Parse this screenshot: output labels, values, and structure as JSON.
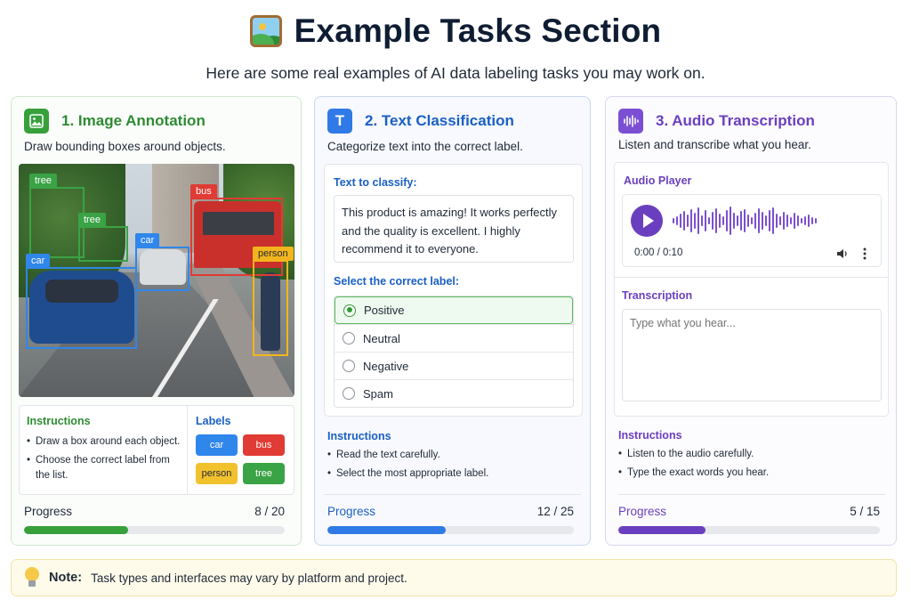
{
  "header": {
    "title": "Example Tasks Section",
    "icon": "landscape-picture-icon",
    "subtitle": "Here are some real examples of AI data labeling tasks you may work on."
  },
  "colors": {
    "green": "#2e8b32",
    "blue": "#1a5fc4",
    "purple": "#6a3fbf",
    "note_bg": "#fffbea"
  },
  "image_task": {
    "title": "1. Image Annotation",
    "description": "Draw bounding boxes around objects.",
    "boxes": [
      {
        "label": "tree",
        "color": "#3aa345"
      },
      {
        "label": "tree",
        "color": "#3aa345"
      },
      {
        "label": "bus",
        "color": "#e03b34"
      },
      {
        "label": "car",
        "color": "#2f86eb"
      },
      {
        "label": "car",
        "color": "#2f86eb"
      },
      {
        "label": "person",
        "color": "#f2b51d"
      }
    ],
    "instructions_title": "Instructions",
    "instructions": [
      "Draw a box around each object.",
      "Choose the correct label from the list."
    ],
    "labels_title": "Labels",
    "labels": [
      {
        "text": "car",
        "color": "#2f86eb"
      },
      {
        "text": "bus",
        "color": "#e03b34"
      },
      {
        "text": "person",
        "color": "#f2c12e"
      },
      {
        "text": "tree",
        "color": "#3aa345"
      }
    ],
    "progress_label": "Progress",
    "progress_text": "8 / 20",
    "progress": 0.4
  },
  "text_task": {
    "title": "2. Text Classification",
    "icon_letter": "T",
    "description": "Categorize text into the correct label.",
    "text_label": "Text to classify:",
    "text": "This product is amazing! It works perfectly and the quality is excellent. I highly recommend it to everyone.",
    "select_label": "Select the correct label:",
    "options": [
      "Positive",
      "Neutral",
      "Negative",
      "Spam"
    ],
    "selected": "Positive",
    "instructions_title": "Instructions",
    "instructions": [
      "Read the text carefully.",
      "Select the most appropriate label."
    ],
    "progress_label": "Progress",
    "progress_text": "12 / 25",
    "progress": 0.48
  },
  "audio_task": {
    "title": "3. Audio Transcription",
    "description": "Listen and transcribe what you hear.",
    "player_label": "Audio Player",
    "time": "0:00 / 0:10",
    "transcription_label": "Transcription",
    "placeholder": "Type what you hear...",
    "instructions_title": "Instructions",
    "instructions": [
      "Listen to the audio carefully.",
      "Type the exact words you hear."
    ],
    "progress_label": "Progress",
    "progress_text": "5 / 15",
    "progress": 0.3333
  },
  "note": {
    "label": "Note:",
    "text": "Task types and interfaces may vary by platform and project."
  }
}
